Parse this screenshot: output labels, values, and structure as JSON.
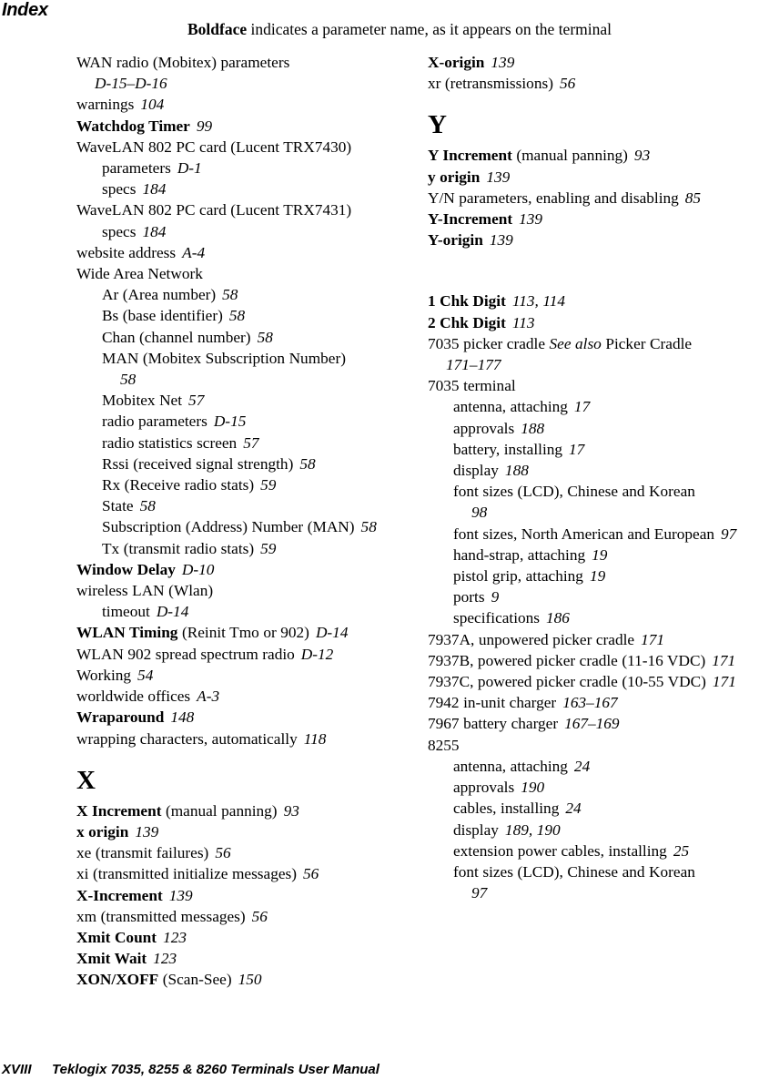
{
  "header": {
    "title": "Index",
    "note_bold": "Boldface",
    "note_rest": " indicates a parameter name, as it appears on the terminal"
  },
  "footer": {
    "folio": "XVIII",
    "manual_title": "Teklogix 7035, 8255 & 8260 Terminals User Manual"
  },
  "columns": {
    "left": [
      {
        "kind": "entry",
        "level": 1,
        "bold": "",
        "text": "WAN radio (Mobitex) parameters",
        "pages": "D-15–D-16",
        "pages_break_before": true
      },
      {
        "kind": "entry",
        "level": 1,
        "bold": "",
        "text": "warnings",
        "pages": "104"
      },
      {
        "kind": "entry",
        "level": 1,
        "bold": "Watchdog Timer",
        "text": "",
        "pages": "99"
      },
      {
        "kind": "entry",
        "level": 1,
        "bold": "",
        "text": "WaveLAN 802 PC card (Lucent TRX7430)",
        "pages": ""
      },
      {
        "kind": "entry",
        "level": 2,
        "bold": "",
        "text": "parameters",
        "pages": "D-1"
      },
      {
        "kind": "entry",
        "level": 2,
        "bold": "",
        "text": "specs",
        "pages": "184"
      },
      {
        "kind": "entry",
        "level": 1,
        "bold": "",
        "text": "WaveLAN 802 PC card (Lucent TRX7431)",
        "pages": ""
      },
      {
        "kind": "entry",
        "level": 2,
        "bold": "",
        "text": "specs",
        "pages": "184"
      },
      {
        "kind": "entry",
        "level": 1,
        "bold": "",
        "text": "website address",
        "pages": "A-4"
      },
      {
        "kind": "entry",
        "level": 1,
        "bold": "",
        "text": "Wide Area Network",
        "pages": ""
      },
      {
        "kind": "entry",
        "level": 2,
        "bold": "",
        "text": "Ar (Area number)",
        "pages": "58"
      },
      {
        "kind": "entry",
        "level": 2,
        "bold": "",
        "text": "Bs (base identifier)",
        "pages": "58"
      },
      {
        "kind": "entry",
        "level": 2,
        "bold": "",
        "text": "Chan (channel number)",
        "pages": "58"
      },
      {
        "kind": "entry",
        "level": 2,
        "bold": "",
        "text": "MAN (Mobitex Subscription Number)",
        "pages": "58",
        "pages_break_before": true
      },
      {
        "kind": "entry",
        "level": 2,
        "bold": "",
        "text": "Mobitex Net",
        "pages": "57"
      },
      {
        "kind": "entry",
        "level": 2,
        "bold": "",
        "text": "radio parameters",
        "pages": "D-15"
      },
      {
        "kind": "entry",
        "level": 2,
        "bold": "",
        "text": "radio statistics screen",
        "pages": "57"
      },
      {
        "kind": "entry",
        "level": 2,
        "bold": "",
        "text": "Rssi (received signal strength)",
        "pages": "58"
      },
      {
        "kind": "entry",
        "level": 2,
        "bold": "",
        "text": "Rx (Receive radio stats)",
        "pages": "59"
      },
      {
        "kind": "entry",
        "level": 2,
        "bold": "",
        "text": "State",
        "pages": "58"
      },
      {
        "kind": "entry",
        "level": 2,
        "bold": "",
        "text": "Subscription (Address) Number (MAN)",
        "pages": "58"
      },
      {
        "kind": "entry",
        "level": 2,
        "bold": "",
        "text": "Tx (transmit radio stats)",
        "pages": "59"
      },
      {
        "kind": "entry",
        "level": 1,
        "bold": "Window Delay",
        "text": "",
        "pages": "D-10"
      },
      {
        "kind": "entry",
        "level": 1,
        "bold": "",
        "text": "wireless LAN (Wlan)",
        "pages": ""
      },
      {
        "kind": "entry",
        "level": 2,
        "bold": "",
        "text": "timeout",
        "pages": "D-14"
      },
      {
        "kind": "entry",
        "level": 1,
        "bold": "WLAN Timing",
        "text": " (Reinit Tmo or 902)",
        "pages": "D-14"
      },
      {
        "kind": "entry",
        "level": 1,
        "bold": "",
        "text": "WLAN 902 spread spectrum radio",
        "pages": "D-12"
      },
      {
        "kind": "entry",
        "level": 1,
        "bold": "",
        "text": "Working",
        "pages": "54"
      },
      {
        "kind": "entry",
        "level": 1,
        "bold": "",
        "text": "worldwide offices",
        "pages": "A-3"
      },
      {
        "kind": "entry",
        "level": 1,
        "bold": "Wraparound",
        "text": "",
        "pages": "148"
      },
      {
        "kind": "entry",
        "level": 1,
        "bold": "",
        "text": "wrapping characters, automatically",
        "pages": "118"
      },
      {
        "kind": "letter",
        "label": "X"
      },
      {
        "kind": "entry",
        "level": 1,
        "bold": "X Increment",
        "text": " (manual panning)",
        "pages": "93"
      },
      {
        "kind": "entry",
        "level": 1,
        "bold": "x origin",
        "text": "",
        "pages": "139"
      },
      {
        "kind": "entry",
        "level": 1,
        "bold": "",
        "text": "xe (transmit failures)",
        "pages": "56"
      },
      {
        "kind": "entry",
        "level": 1,
        "bold": "",
        "text": "xi (transmitted initialize messages)",
        "pages": "56"
      },
      {
        "kind": "entry",
        "level": 1,
        "bold": "X-Increment",
        "text": "",
        "pages": "139"
      },
      {
        "kind": "entry",
        "level": 1,
        "bold": "",
        "text": "xm (transmitted messages)",
        "pages": "56"
      },
      {
        "kind": "entry",
        "level": 1,
        "bold": "Xmit Count",
        "text": "",
        "pages": "123"
      },
      {
        "kind": "entry",
        "level": 1,
        "bold": "Xmit Wait",
        "text": "",
        "pages": "123"
      },
      {
        "kind": "entry",
        "level": 1,
        "bold": "XON/XOFF",
        "text": " (Scan-See)",
        "pages": "150"
      }
    ],
    "right": [
      {
        "kind": "entry",
        "level": 1,
        "bold": "X-origin",
        "text": "",
        "pages": "139"
      },
      {
        "kind": "entry",
        "level": 1,
        "bold": "",
        "text": "xr (retransmissions)",
        "pages": "56"
      },
      {
        "kind": "letter",
        "label": "Y"
      },
      {
        "kind": "entry",
        "level": 1,
        "bold": "Y Increment",
        "text": " (manual panning)",
        "pages": "93"
      },
      {
        "kind": "entry",
        "level": 1,
        "bold": "y origin",
        "text": "",
        "pages": "139"
      },
      {
        "kind": "entry",
        "level": 1,
        "bold": "",
        "text": "Y/N parameters, enabling and disabling",
        "pages": "85"
      },
      {
        "kind": "entry",
        "level": 1,
        "bold": "Y-Increment",
        "text": "",
        "pages": "139"
      },
      {
        "kind": "entry",
        "level": 1,
        "bold": "Y-origin",
        "text": "",
        "pages": "139"
      },
      {
        "kind": "gap"
      },
      {
        "kind": "entry",
        "level": 1,
        "bold": "1 Chk Digit",
        "text": "",
        "pages": "113, 114"
      },
      {
        "kind": "entry",
        "level": 1,
        "bold": "2 Chk Digit",
        "text": "",
        "pages": "113"
      },
      {
        "kind": "entry",
        "level": 1,
        "bold": "",
        "text": "7035 picker cradle ",
        "italic_text": "See also",
        "text_after": " Picker Cradle",
        "pages": "171–177",
        "pages_break_before": true
      },
      {
        "kind": "entry",
        "level": 1,
        "bold": "",
        "text": "7035 terminal",
        "pages": ""
      },
      {
        "kind": "entry",
        "level": 2,
        "bold": "",
        "text": "antenna, attaching",
        "pages": "17"
      },
      {
        "kind": "entry",
        "level": 2,
        "bold": "",
        "text": "approvals",
        "pages": "188"
      },
      {
        "kind": "entry",
        "level": 2,
        "bold": "",
        "text": "battery, installing",
        "pages": "17"
      },
      {
        "kind": "entry",
        "level": 2,
        "bold": "",
        "text": "display",
        "pages": "188"
      },
      {
        "kind": "entry",
        "level": 2,
        "bold": "",
        "text": "font sizes (LCD), Chinese and Korean",
        "pages": "98",
        "pages_break_before": true
      },
      {
        "kind": "entry",
        "level": 2,
        "bold": "",
        "text": "font sizes, North American and European",
        "pages": "97"
      },
      {
        "kind": "entry",
        "level": 2,
        "bold": "",
        "text": "hand-strap, attaching",
        "pages": "19"
      },
      {
        "kind": "entry",
        "level": 2,
        "bold": "",
        "text": "pistol grip, attaching",
        "pages": "19"
      },
      {
        "kind": "entry",
        "level": 2,
        "bold": "",
        "text": "ports",
        "pages": "9"
      },
      {
        "kind": "entry",
        "level": 2,
        "bold": "",
        "text": "specifications",
        "pages": "186"
      },
      {
        "kind": "entry",
        "level": 1,
        "bold": "",
        "text": "7937A, unpowered picker cradle",
        "pages": "171"
      },
      {
        "kind": "entry",
        "level": 1,
        "bold": "",
        "text": "7937B, powered picker cradle (11-16 VDC)",
        "pages": "171"
      },
      {
        "kind": "entry",
        "level": 1,
        "bold": "",
        "text": "7937C, powered picker cradle (10-55 VDC)",
        "pages": "171"
      },
      {
        "kind": "entry",
        "level": 1,
        "bold": "",
        "text": "7942 in-unit charger",
        "pages": "163–167"
      },
      {
        "kind": "entry",
        "level": 1,
        "bold": "",
        "text": "7967 battery charger",
        "pages": "167–169"
      },
      {
        "kind": "entry",
        "level": 1,
        "bold": "",
        "text": "8255",
        "pages": ""
      },
      {
        "kind": "entry",
        "level": 2,
        "bold": "",
        "text": "antenna, attaching",
        "pages": "24"
      },
      {
        "kind": "entry",
        "level": 2,
        "bold": "",
        "text": "approvals",
        "pages": "190"
      },
      {
        "kind": "entry",
        "level": 2,
        "bold": "",
        "text": "cables, installing",
        "pages": "24"
      },
      {
        "kind": "entry",
        "level": 2,
        "bold": "",
        "text": "display",
        "pages": "189, 190"
      },
      {
        "kind": "entry",
        "level": 2,
        "bold": "",
        "text": "extension power cables, installing",
        "pages": "25"
      },
      {
        "kind": "entry",
        "level": 2,
        "bold": "",
        "text": "font sizes (LCD), Chinese and Korean",
        "pages": "97",
        "pages_break_before": true
      }
    ]
  }
}
